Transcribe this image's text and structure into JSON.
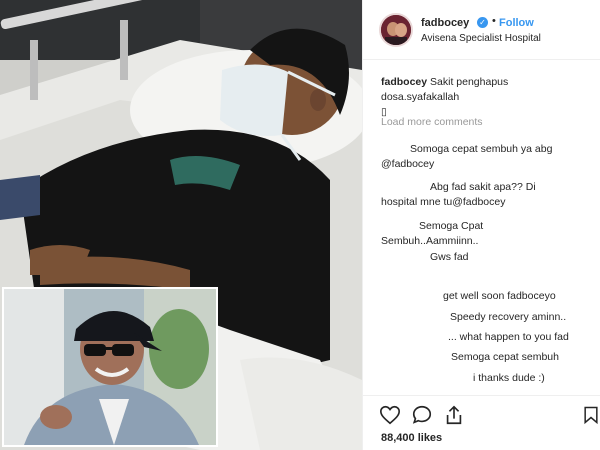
{
  "post": {
    "username": "fadbocey",
    "follow_label": "Follow",
    "separator": "•",
    "location": "Avisena Specialist Hospital",
    "caption_user": "fadbocey",
    "caption_text": "Sakit penghapus dosa.syafakallah",
    "caption_extra": "▯",
    "load_more": "Load more comments",
    "likes": "88,400 likes"
  },
  "comments": [
    "Somoga cepat sembuh ya abg",
    "@fadbocey",
    "Abg fad sakit apa?? Di",
    "hospital mne tu@fadbocey",
    "Semoga Cpat",
    "Sembuh..Aammiinn..",
    "Gws fad",
    "get well soon fadboceyo",
    "Speedy recovery aminn..",
    "... what happen to you fad",
    "Semoga cepat sembuh",
    "i thanks dude :)"
  ],
  "colors": {
    "accent": "#3897f0",
    "muted": "#999999",
    "text": "#262626"
  },
  "icons": [
    "verified-badge-icon",
    "heart-icon",
    "comment-icon",
    "share-icon",
    "bookmark-icon"
  ]
}
